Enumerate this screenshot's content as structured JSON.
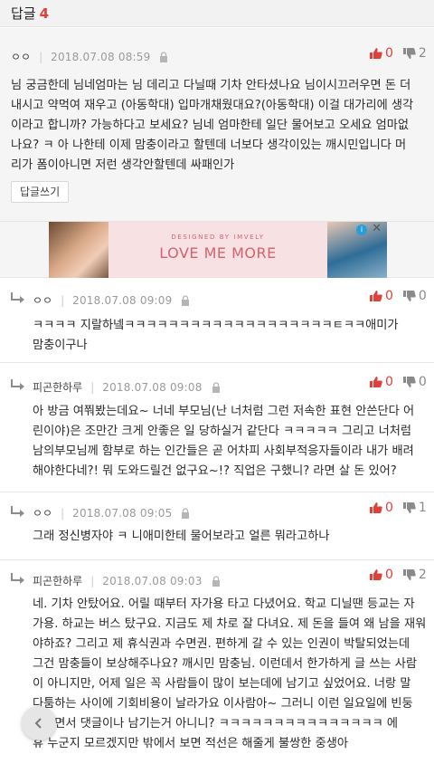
{
  "header": {
    "title": "답글",
    "count": "4"
  },
  "comment": {
    "author": "ㅇㅇ",
    "date": "2018.07.08 08:59",
    "up": "0",
    "down": "2",
    "lines": [
      "님 궁금한데 님네엄마는 님 데리고 다닐때 기차 안타셨나요 님이시끄러우면 돈 더",
      "내시고 약먹여 재우고 (아동학대) 입마개채웠대요?(아동학대) 이걸 대가리에 생각",
      "이라고 합니까? 가능하다고 보세요? 님네 엄마한테 일단 물어보고 오세요 엄마없",
      "나요? ㅋ 아 나한테 이제 맘충이라고 할텐데 너보다 생각이있는 깨시민입니다 머",
      "리가 폼이아니면 저런 생각안할텐데 싸패인가"
    ],
    "reply_button": "답글쓰기"
  },
  "ad": {
    "designed": "DESIGNED BY  IMVELY",
    "headline": "LOVE ME MORE",
    "info": "i",
    "close": "✕"
  },
  "replies": [
    {
      "author": "ㅇㅇ",
      "date": "2018.07.08 09:09",
      "up": "0",
      "down": "0",
      "lines": [
        "ㅋㅋㅋㅋ 지랄하넼ㅋㅋㅋㅋㅋㅋㅋㅋㅋㅋㅋㅋㅋㅋㅋㅋㅋㅋㅋㅌㅋㅋ애미가",
        "맘충이구나"
      ]
    },
    {
      "author": "피곤한하루",
      "date": "2018.07.08 09:08",
      "up": "0",
      "down": "0",
      "lines": [
        "아 방금 여쭤봤는데요~ 너네 부모님(난 너처럼 그런 저속한 표현 안쓴단다 어",
        "린이야)은 조만간 크게 안좋은 일 당하실거 같단다 ㅋㅋㅋㅋㅋ 그리고 너처럼",
        "남의부모님께 함부로 하는 인간들은 곧 어차피 사회부적응자들이라 내가 배려",
        "해야한다네?! 뭐 도와드릴건 없구요~!? 직업은 구했니? 라면 살 돈 있어?"
      ]
    },
    {
      "author": "ㅇㅇ",
      "date": "2018.07.08 09:05",
      "up": "0",
      "down": "1",
      "lines": [
        "그래 정신병자야 ㅋ 니애미한테 물어보라고 얼른 뭐라고하나"
      ]
    },
    {
      "author": "피곤한하루",
      "date": "2018.07.08 09:03",
      "up": "0",
      "down": "2",
      "lines": [
        "네. 기차 안탔어요. 어릴 때부터 자가용 타고 다녔어요. 학교 디닐땐 등교는 자",
        "가용. 하교는 버스 탔구요. 지금도 제 차로 잘 다녀요. 제 돈을 들여 왜 남을 재워",
        "야하죠? 그리고 제 휴식권과 수면권. 편하게 갈 수 있는 인권이 박탈되었는데",
        "그건 맘충들이 보상해주나요? 깨시민 맘충님. 이런데서 한가하게 글 쓰는 사람",
        "이 아니지만, 어제 일은 꼭 사람들이 많이 보는데에 남기고 싶었어요. 너랑 말",
        "다툼하는 사이에 기회비용이 날라가요 이사람아~ 그러니 이런 일요일에 빈둥",
        "거리면서 댓글이나 남기는거 아니니? ㅋㅋㅋㅋㅋㅋㅋㅋㅋㅋㅋㅋㅋㅋㅋ 에",
        "휴 누군지 모르겠지만 밖에서 보면 적선은 해줄게 불쌍한 중생아"
      ]
    }
  ]
}
